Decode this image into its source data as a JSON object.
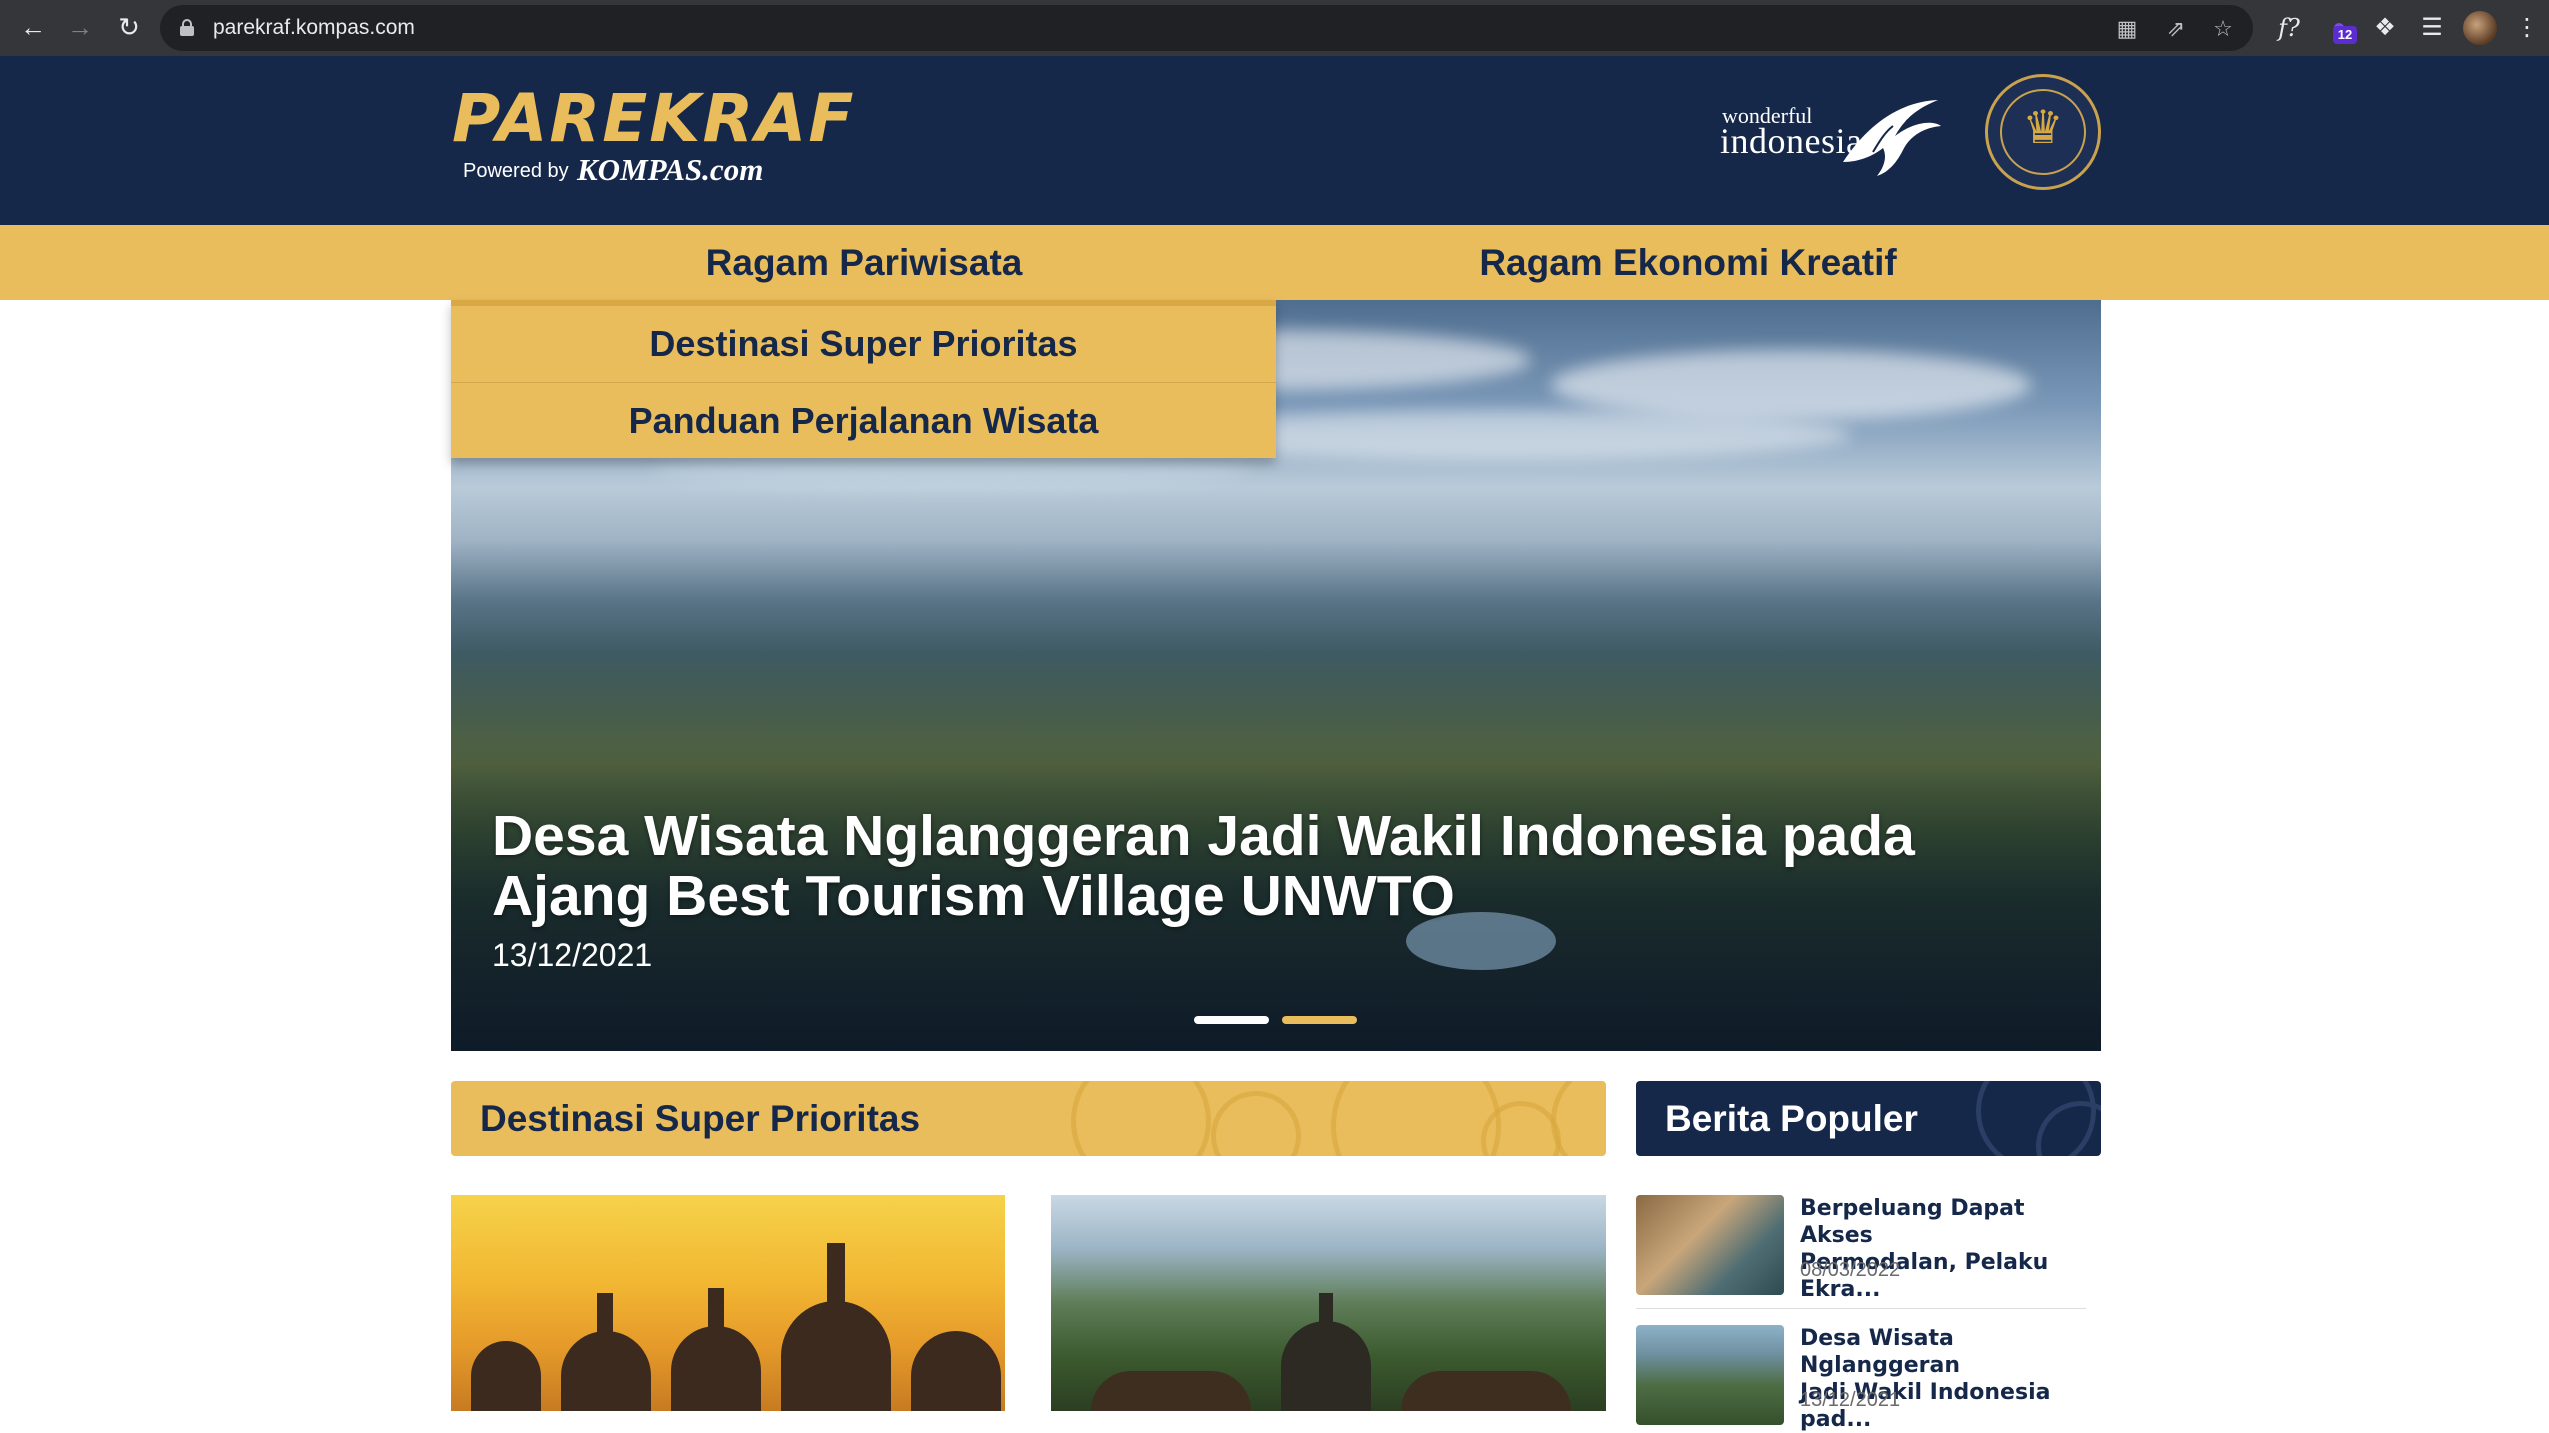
{
  "browser": {
    "url": "parekraf.kompas.com",
    "extension_badge": "12"
  },
  "header": {
    "logo_main": "PAREKRAF",
    "logo_powered": "Powered by",
    "logo_kompas": "KOMPAS.com",
    "wi_wonderful": "wonderful",
    "wi_indonesia": "indonesia"
  },
  "nav": {
    "items": [
      {
        "label": "Ragam Pariwisata"
      },
      {
        "label": "Ragam Ekonomi Kreatif"
      }
    ],
    "dropdown": [
      {
        "label": "Destinasi Super Prioritas"
      },
      {
        "label": "Panduan Perjalanan Wisata"
      }
    ]
  },
  "hero": {
    "title": "Desa Wisata Nglanggeran Jadi Wakil Indonesia pada Ajang Best Tourism Village UNWTO",
    "date": "13/12/2021",
    "slide_count": 2,
    "active_slide": 1
  },
  "sections": {
    "destinasi_title": "Destinasi Super Prioritas",
    "populer_title": "Berita Populer"
  },
  "popular": [
    {
      "title": "Berpeluang Dapat Akses\nPermodalan, Pelaku Ekra...",
      "date": "08/03/2022"
    },
    {
      "title": "Desa Wisata Nglanggeran\nJadi Wakil Indonesia pad...",
      "date": "13/12/2021"
    }
  ],
  "colors": {
    "navy": "#16284a",
    "gold": "#e9bd5c"
  }
}
